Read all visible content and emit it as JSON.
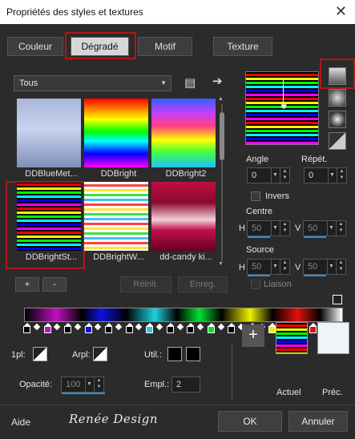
{
  "window": {
    "title": "Propriétés des styles et textures",
    "close": "✕"
  },
  "tabs": [
    "Couleur",
    "Dégradé",
    "Motif",
    "Texture"
  ],
  "library": {
    "filter": "Tous",
    "items": [
      {
        "name": "DDBlueMet...",
        "gradient": "linear-gradient(#a9b6d8,#c8d3ee 45%,#7f8fb8)"
      },
      {
        "name": "DDBright",
        "gradient": "linear-gradient(#ff0000,#ff8000 15%,#ffff00 30%,#00ff00 48%,#00ffff 62%,#0000ff 80%,#ff00ff)"
      },
      {
        "name": "DDBright2",
        "gradient": "linear-gradient(#3060ff,#c040ff 20%,#ff4080 40%,#ffff00 60%,#40ff40 78%,#20c0ff)"
      },
      {
        "name": "DDBrightSt...",
        "gradient": "repeating-linear-gradient(#000 0px,#000 2px,#ff0000 2px,#ff0000 5px,#000 5px,#000 7px,#ffff00 7px,#ffff00 10px,#000 10px,#000 12px,#00ff00 12px,#00ff00 15px,#000 15px,#000 17px,#00ffff 17px,#00ffff 20px,#000 20px,#000 22px,#0000ff 22px,#0000ff 25px,#000 25px,#000 27px,#ff00ff 27px,#ff00ff 30px)"
      },
      {
        "name": "DDBrightW...",
        "gradient": "repeating-linear-gradient(#fff 0px,#fff 3px,#ff4040 3px,#ff4040 6px,#fff 6px,#fff 9px,#ffe040 9px,#ffe040 12px,#fff 12px,#fff 15px,#40e040 15px,#40e040 18px,#fff 18px,#fff 21px,#40c0ff 21px,#40c0ff 24px)"
      },
      {
        "name": "dd-candy ki...",
        "gradient": "linear-gradient(#c01040,#8a0830 30%,#f0d0d8 55%,#c0104a 70%,#6a0020)"
      }
    ],
    "buttons": {
      "add": "+",
      "remove": "-",
      "reset": "Réinit.",
      "save": "Enreg."
    }
  },
  "properties": {
    "angle_label": "Angle",
    "angle": "0",
    "repeat_label": "Répét.",
    "repeat": "0",
    "invert_label": "Invers",
    "center_label": "Centre",
    "center_h_label": "H",
    "center_h": "50",
    "center_v_label": "V",
    "center_v": "50",
    "source_label": "Source",
    "source_h_label": "H",
    "source_h": "50",
    "source_v_label": "V",
    "source_v": "50",
    "link_label": "Liaison"
  },
  "editor": {
    "opacity_label": "Opacité:",
    "opacity": "100",
    "location_label": "Empl.:",
    "location": "2",
    "left_label": "1pl:",
    "right_label": "Arpl:",
    "use_label": "Util.:"
  },
  "current": {
    "current_label": "Actuel",
    "previous_label": "Préc."
  },
  "footer": {
    "help": "Aide",
    "logo": "Renée Design",
    "ok": "OK",
    "cancel": "Annuler"
  },
  "stop_colors": [
    "#000000",
    "#c010c0",
    "#000000",
    "#1010e0",
    "#000000",
    "#000000",
    "#20d0e0",
    "#000000",
    "#000000",
    "#00e030",
    "#000000",
    "#000000",
    "#f0f000",
    "#000000",
    "#e01010",
    "#ffffff"
  ]
}
